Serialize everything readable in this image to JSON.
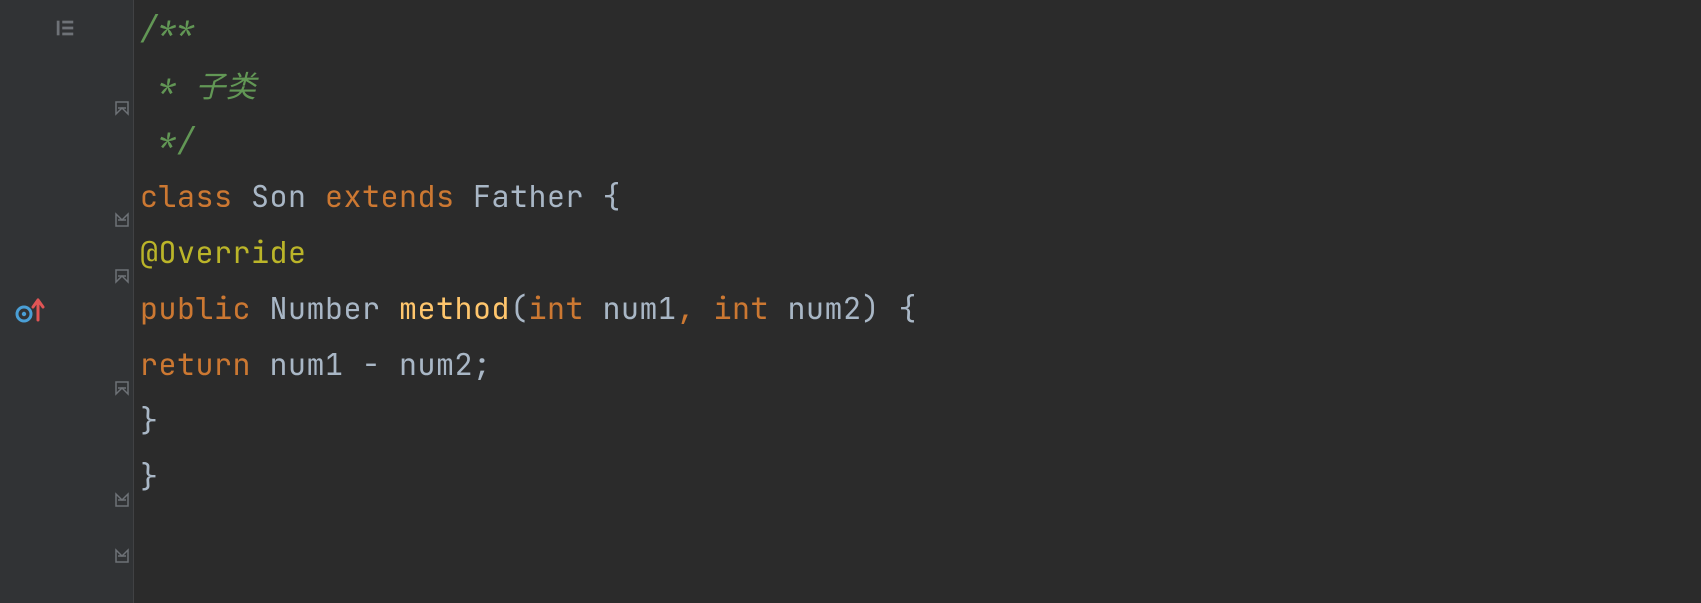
{
  "code": {
    "line1": {
      "t1": "/**"
    },
    "line2": {
      "t1": " * 子类"
    },
    "line3": {
      "t1": " */"
    },
    "line4": {
      "t1": "class",
      "t2": " Son ",
      "t3": "extends",
      "t4": " Father {"
    },
    "line5": {
      "t1": "@Override"
    },
    "line6": {
      "t1": "public",
      "t2": " Number ",
      "t3": "method",
      "t4": "(",
      "t5": "int",
      "t6": " num1",
      "t7": ", ",
      "t8": "int",
      "t9": " num2) {"
    },
    "line7": {
      "t1": "return",
      "t2": " num1 - num2;"
    },
    "line8": {
      "t1": "}"
    },
    "line9": {
      "t1": "}"
    }
  }
}
